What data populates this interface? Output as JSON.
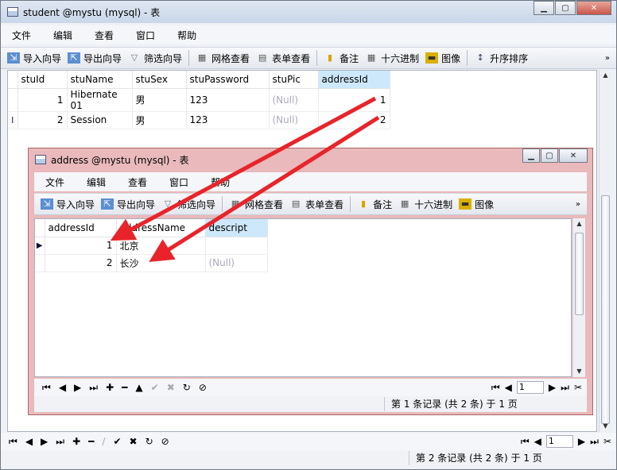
{
  "win1": {
    "title": "student @mystu (mysql) - 表",
    "menu": [
      "文件",
      "编辑",
      "查看",
      "窗口",
      "帮助"
    ],
    "toolbar": {
      "import": "导入向导",
      "export": "导出向导",
      "filter": "筛选向导",
      "grid": "网格查看",
      "form": "表单查看",
      "memo": "备注",
      "hex": "十六进制",
      "image": "图像",
      "sort": "升序排序",
      "more": "»"
    },
    "columns": [
      "stuId",
      "stuName",
      "stuSex",
      "stuPassword",
      "stuPic",
      "addressId"
    ],
    "rows": [
      {
        "stuId": "1",
        "stuName": "Hibernate 01",
        "stuSex": "男",
        "stuPassword": "123",
        "stuPic": "(Null)",
        "addressId": "1"
      },
      {
        "stuId": "2",
        "stuName": "Session",
        "stuSex": "男",
        "stuPassword": "123",
        "stuPic": "(Null)",
        "addressId": "2"
      }
    ],
    "row_indicator": "I",
    "page": "1",
    "status": "第 2 条记录 (共 2 条) 于 1 页"
  },
  "win2": {
    "title": "address @mystu (mysql) - 表",
    "menu": [
      "文件",
      "编辑",
      "查看",
      "窗口",
      "帮助"
    ],
    "toolbar": {
      "import": "导入向导",
      "export": "导出向导",
      "filter": "筛选向导",
      "grid": "网格查看",
      "form": "表单查看",
      "memo": "备注",
      "hex": "十六进制",
      "image": "图像",
      "more": "»"
    },
    "columns": [
      "addressId",
      "addressName",
      "descript"
    ],
    "rows": [
      {
        "addressId": "1",
        "addressName": "北京",
        "descript": ""
      },
      {
        "addressId": "2",
        "addressName": "长沙",
        "descript": "(Null)"
      }
    ],
    "page": "1",
    "status": "第 1 条记录 (共 2 条) 于 1 页"
  },
  "colors": {
    "arrow": "#e8242a",
    "selected_header": "#cde8fb",
    "inner_frame": "#e9b9bb"
  }
}
